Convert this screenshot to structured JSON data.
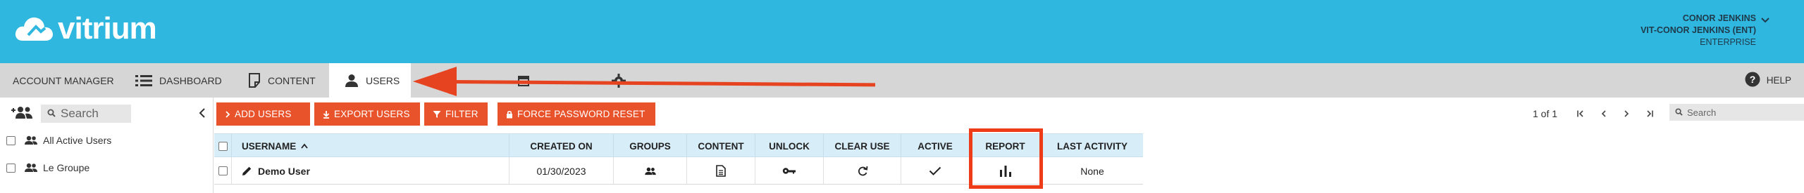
{
  "header": {
    "logo_text": "vitrium",
    "user_name": "CONOR JENKINS",
    "account": "VIT-CONOR JENKINS (ENT)",
    "plan": "ENTERPRISE"
  },
  "nav": {
    "items": [
      {
        "label": "ACCOUNT MANAGER",
        "icon": "none"
      },
      {
        "label": "DASHBOARD",
        "icon": "list-icon"
      },
      {
        "label": "CONTENT",
        "icon": "document-icon"
      },
      {
        "label": "USERS",
        "icon": "person-icon",
        "active": true
      }
    ],
    "help_label": "HELP"
  },
  "sidebar": {
    "search_placeholder": "Search",
    "groups": [
      {
        "label": "All Active Users"
      },
      {
        "label": "Le Groupe"
      }
    ]
  },
  "toolbar": {
    "add_users": "ADD USERS",
    "export_users": "EXPORT USERS",
    "filter": "FILTER",
    "force_password_reset": "FORCE PASSWORD RESET",
    "page_info": "1 of 1",
    "search_placeholder": "Search"
  },
  "table": {
    "columns": [
      "USERNAME",
      "CREATED ON",
      "GROUPS",
      "CONTENT",
      "UNLOCK",
      "CLEAR USE",
      "ACTIVE",
      "REPORT",
      "LAST ACTIVITY"
    ],
    "rows": [
      {
        "username": "Demo User",
        "created_on": "01/30/2023",
        "last_activity": "None"
      }
    ]
  },
  "colors": {
    "header_bg": "#2fb7e0",
    "accent_orange": "#e9532b",
    "annotation_red": "#e64320",
    "table_header_bg": "#d7edf8",
    "nav_bg": "#d6d6d6"
  }
}
